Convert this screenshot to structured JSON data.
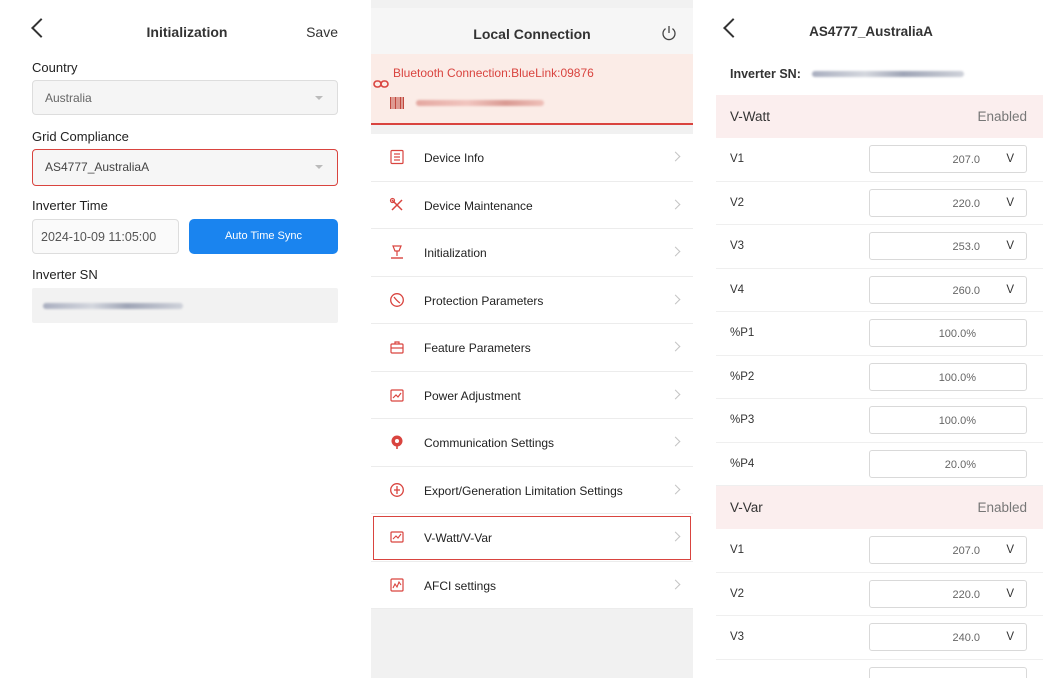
{
  "panel1": {
    "title": "Initialization",
    "save_label": "Save",
    "country_label": "Country",
    "country_value": "Australia",
    "grid_label": "Grid Compliance",
    "grid_value": "AS4777_AustraliaA",
    "time_label": "Inverter Time",
    "time_value": "2024-10-09 11:05:00",
    "sync_label": "Auto Time Sync",
    "sn_label": "Inverter SN"
  },
  "panel2": {
    "title": "Local Connection",
    "bluetooth": "Bluetooth Connection:BlueLink:09876",
    "menu": [
      {
        "label": "Device Info",
        "icon": "document-icon"
      },
      {
        "label": "Device Maintenance",
        "icon": "tools-icon"
      },
      {
        "label": "Initialization",
        "icon": "init-icon"
      },
      {
        "label": "Protection Parameters",
        "icon": "shield-icon"
      },
      {
        "label": "Feature Parameters",
        "icon": "toolbox-icon"
      },
      {
        "label": "Power Adjustment",
        "icon": "chart-icon"
      },
      {
        "label": "Communication Settings",
        "icon": "antenna-icon"
      },
      {
        "label": "Export/Generation Limitation Settings",
        "icon": "gauge-icon"
      },
      {
        "label": "V-Watt/V-Var",
        "icon": "monitor-icon"
      },
      {
        "label": "AFCI settings",
        "icon": "wave-chart-icon"
      }
    ]
  },
  "panel3": {
    "title": "AS4777_AustraliaA",
    "sn_label": "Inverter SN:",
    "vwatt": {
      "name": "V-Watt",
      "status": "Enabled",
      "rows": [
        {
          "name": "V1",
          "value": "207.0",
          "unit": "V"
        },
        {
          "name": "V2",
          "value": "220.0",
          "unit": "V"
        },
        {
          "name": "V3",
          "value": "253.0",
          "unit": "V"
        },
        {
          "name": "V4",
          "value": "260.0",
          "unit": "V"
        },
        {
          "name": "%P1",
          "value": "100.0%",
          "unit": ""
        },
        {
          "name": "%P2",
          "value": "100.0%",
          "unit": ""
        },
        {
          "name": "%P3",
          "value": "100.0%",
          "unit": ""
        },
        {
          "name": "%P4",
          "value": "20.0%",
          "unit": ""
        }
      ]
    },
    "vvar": {
      "name": "V-Var",
      "status": "Enabled",
      "rows": [
        {
          "name": "V1",
          "value": "207.0",
          "unit": "V"
        },
        {
          "name": "V2",
          "value": "220.0",
          "unit": "V"
        },
        {
          "name": "V3",
          "value": "240.0",
          "unit": "V"
        }
      ]
    }
  },
  "colors": {
    "accent_blue": "#1a84ef",
    "highlight_red": "#d9443f",
    "section_bg": "#fbeeee",
    "connection_bg": "#fbece7"
  }
}
